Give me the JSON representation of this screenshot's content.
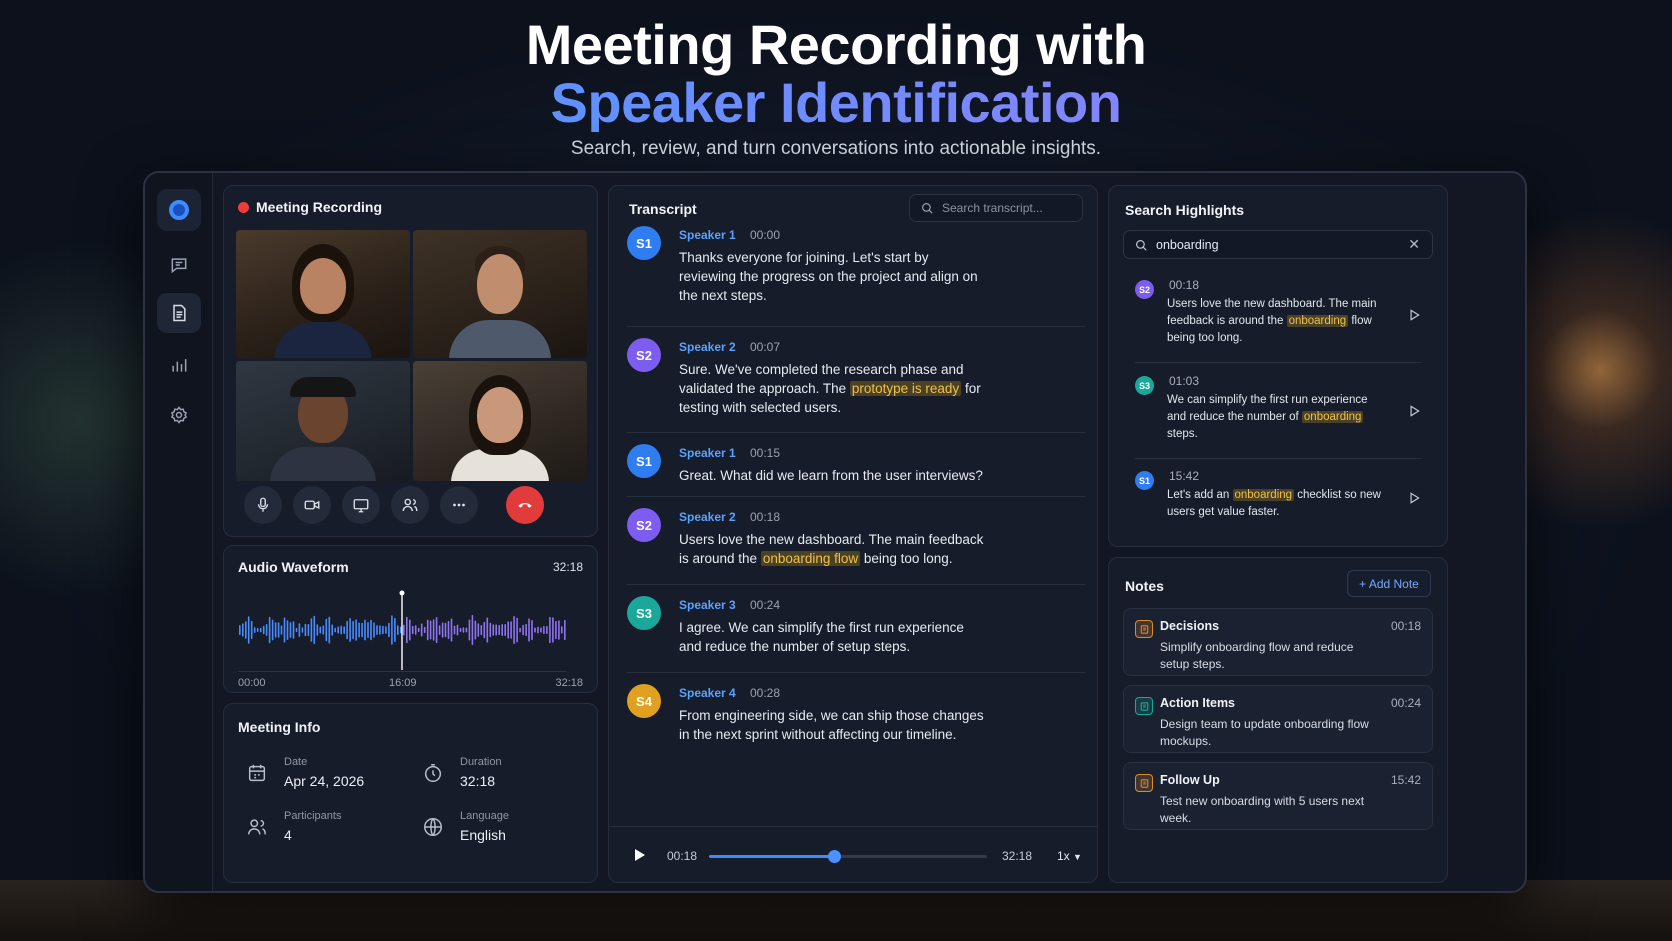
{
  "hero": {
    "title_line1": "Meeting Recording with",
    "title_line2": "Speaker Identification",
    "subtitle": "Search, review, and turn conversations into actionable insights."
  },
  "colors": {
    "accent": "#3d8bff",
    "record": "#ef3b3b",
    "highlight": "#f0c04a",
    "s1": "#2f7df0",
    "s2": "#7d5cf0",
    "s3": "#1aa89a",
    "s4": "#e0a020"
  },
  "sidebar": {
    "icons": [
      "logo-icon",
      "chat-icon",
      "document-icon",
      "bar-chart-icon",
      "gear-icon"
    ],
    "active": "document-icon"
  },
  "recording": {
    "title": "Meeting Recording",
    "controls": [
      "microphone-icon",
      "camera-icon",
      "screen-share-icon",
      "participants-icon",
      "more-icon",
      "end-call-icon"
    ]
  },
  "waveform": {
    "title": "Audio Waveform",
    "duration": "32:18",
    "ticks": [
      "00:00",
      "16:09",
      "32:18"
    ],
    "playhead_fraction": 0.5
  },
  "meeting_info": {
    "title": "Meeting Info",
    "date_label": "Date",
    "date": "Apr 24, 2026",
    "duration_label": "Duration",
    "duration": "32:18",
    "participants_label": "Participants",
    "participants": "4",
    "language_label": "Language",
    "language": "English"
  },
  "transcript": {
    "title": "Transcript",
    "search_placeholder": "Search transcript...",
    "entries": [
      {
        "badge": "S1",
        "speaker": "Speaker 1",
        "time": "00:00",
        "pre": "Thanks everyone for joining. Let's start by reviewing the progress on the project and align on the next steps.",
        "highlight": "",
        "post": ""
      },
      {
        "badge": "S2",
        "speaker": "Speaker 2",
        "time": "00:07",
        "pre": "Sure. We've completed the research phase and validated the approach. The ",
        "highlight": "prototype is ready",
        "post": " for testing with selected users."
      },
      {
        "badge": "S1",
        "speaker": "Speaker 1",
        "time": "00:15",
        "pre": "Great. What did we learn from the user interviews?",
        "highlight": "",
        "post": ""
      },
      {
        "badge": "S2",
        "speaker": "Speaker 2",
        "time": "00:18",
        "pre": "Users love the new dashboard. The main feedback is around the ",
        "highlight": "onboarding flow",
        "post": " being too long."
      },
      {
        "badge": "S3",
        "speaker": "Speaker 3",
        "time": "00:24",
        "pre": "I agree. We can simplify the first run experience and reduce the number of setup steps.",
        "highlight": "",
        "post": ""
      },
      {
        "badge": "S4",
        "speaker": "Speaker 4",
        "time": "00:28",
        "pre": "From engineering side, we can ship those changes in the next sprint without affecting our timeline.",
        "highlight": "",
        "post": ""
      }
    ],
    "player": {
      "current": "00:18",
      "total": "32:18",
      "progress_fraction": 0.45,
      "speed": "1x"
    }
  },
  "highlights": {
    "title": "Search Highlights",
    "query": "onboarding",
    "items": [
      {
        "badge": "S2",
        "time": "00:18",
        "pre": "Users love the new dashboard. The main feedback is around the ",
        "highlight": "onboarding",
        "post": " flow being too long."
      },
      {
        "badge": "S3",
        "time": "01:03",
        "pre": "We can simplify the first run experience and reduce the number of ",
        "highlight": "onboarding",
        "post": " steps."
      },
      {
        "badge": "S1",
        "time": "15:42",
        "pre": "Let's add an ",
        "highlight": "onboarding",
        "post": " checklist so new users get value faster."
      }
    ]
  },
  "notes": {
    "title": "Notes",
    "add_label": "+ Add Note",
    "items": [
      {
        "title": "Decisions",
        "time": "00:18",
        "text": "Simplify onboarding flow and reduce setup steps.",
        "icon": "decision-icon",
        "color": "#e0892a"
      },
      {
        "title": "Action Items",
        "time": "00:24",
        "text": "Design team to update onboarding flow mockups.",
        "icon": "checklist-icon",
        "color": "#1aa89a"
      },
      {
        "title": "Follow Up",
        "time": "15:42",
        "text": "Test new onboarding with 5 users next week.",
        "icon": "follow-up-icon",
        "color": "#e0892a"
      }
    ]
  }
}
